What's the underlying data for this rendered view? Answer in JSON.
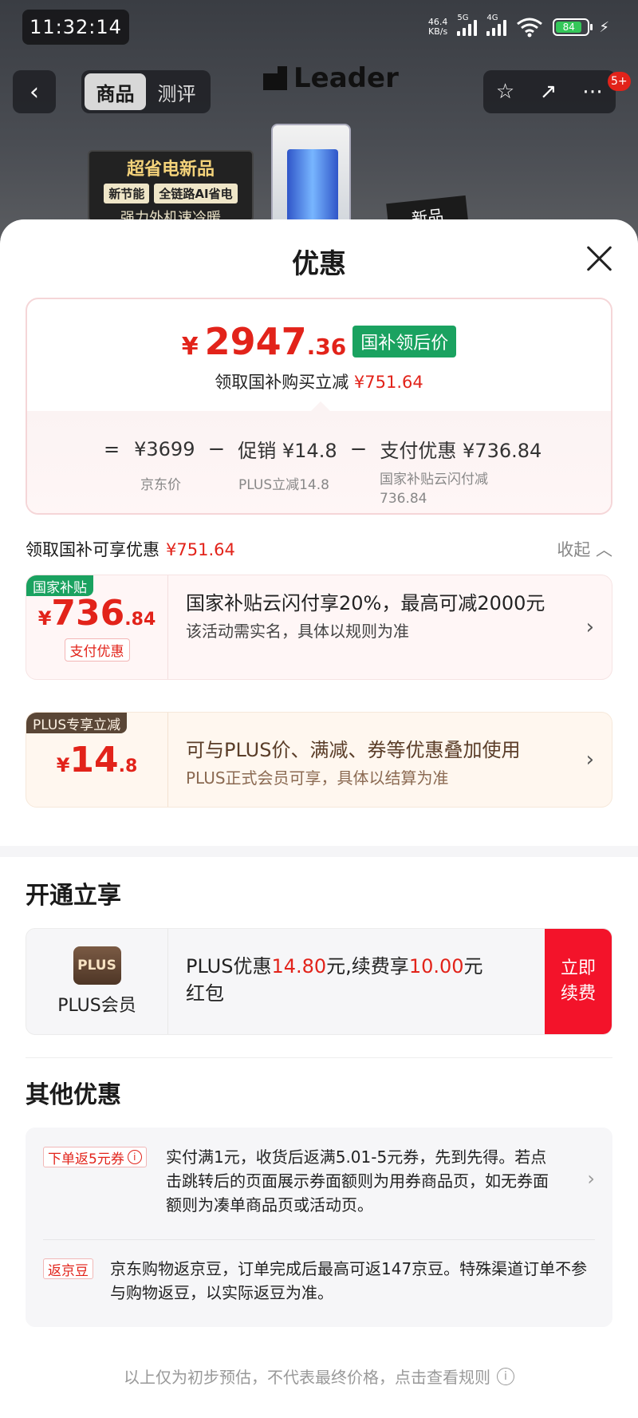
{
  "status_bar": {
    "time": "11:32:14",
    "net_speed_value": "46.4",
    "net_speed_unit": "KB/s",
    "sig1_label": "5G",
    "sig2_label": "4G",
    "wifi_label": "6",
    "battery": "84"
  },
  "nav": {
    "back": "‹",
    "tabs": [
      "商品",
      "测评"
    ],
    "brand": "Leader",
    "actions": [
      "☆",
      "↗",
      "⋯"
    ],
    "badge": "5+"
  },
  "background_promo": {
    "line1": "超省电新品",
    "chip1": "新节能",
    "chip2": "全链路AI省电",
    "line3": "强力外机速冷暖",
    "new_tag": "新品"
  },
  "sheet": {
    "title": "优惠",
    "price_card": {
      "currency": "¥",
      "price_int": "2947",
      "price_dec": ".36",
      "price_tag": "国补领后价",
      "subtitle_prefix": "领取国补购买立减",
      "subtitle_amount": "¥751.64",
      "formula": {
        "equals": "=",
        "jd_price": "¥3699",
        "minus1": "−",
        "promo": "促销 ¥14.8",
        "minus2": "−",
        "pay": "支付优惠 ¥736.84",
        "jd_label": "京东价",
        "promo_label": "PLUS立减14.8",
        "pay_label_line1": "国家补贴云闪付减",
        "pay_label_line2": "736.84"
      }
    },
    "can_enjoy": {
      "label": "领取国补可享优惠",
      "amount": "¥751.64",
      "collapse": "收起 ︿"
    },
    "deal1": {
      "tag": "国家补贴",
      "yen": "¥",
      "int": "736",
      "dec": ".84",
      "small_tag": "支付优惠",
      "title": "国家补贴云闪付享20%，最高可减2000元",
      "desc": "该活动需实名，具体以规则为准",
      "chevron": "›"
    },
    "deal2": {
      "tag": "PLUS专享立减",
      "yen": "¥",
      "int": "14",
      "dec": ".8",
      "title": "可与PLUS价、满减、券等优惠叠加使用",
      "desc": "PLUS正式会员可享，具体以结算为准",
      "chevron": "›"
    },
    "open_section": {
      "title": "开通立享",
      "plus_logo": "PLUS",
      "plus_name": "PLUS会员",
      "text_a": "PLUS优惠",
      "text_b": "14.80",
      "text_c": "元,续费享",
      "text_d": "10.00",
      "text_e": "元红包",
      "button_line1": "立即",
      "button_line2": "续费"
    },
    "other_section": {
      "title": "其他优惠",
      "item1_tag": "下单返5元券",
      "item1_text": "实付满1元，收货后返满5.01-5元券，先到先得。若点击跳转后的页面展示券面额则为用券商品页，如无券面额则为凑单商品页或活动页。",
      "item1_chevron": "›",
      "item2_tag": "返京豆",
      "item2_text": "京东购物返京豆，订单完成后最高可返147京豆。特殊渠道订单不参与购物返豆，以实际返豆为准。"
    },
    "footer": "以上仅为初步预估，不代表最终价格，点击查看规则",
    "info_icon": "i"
  }
}
